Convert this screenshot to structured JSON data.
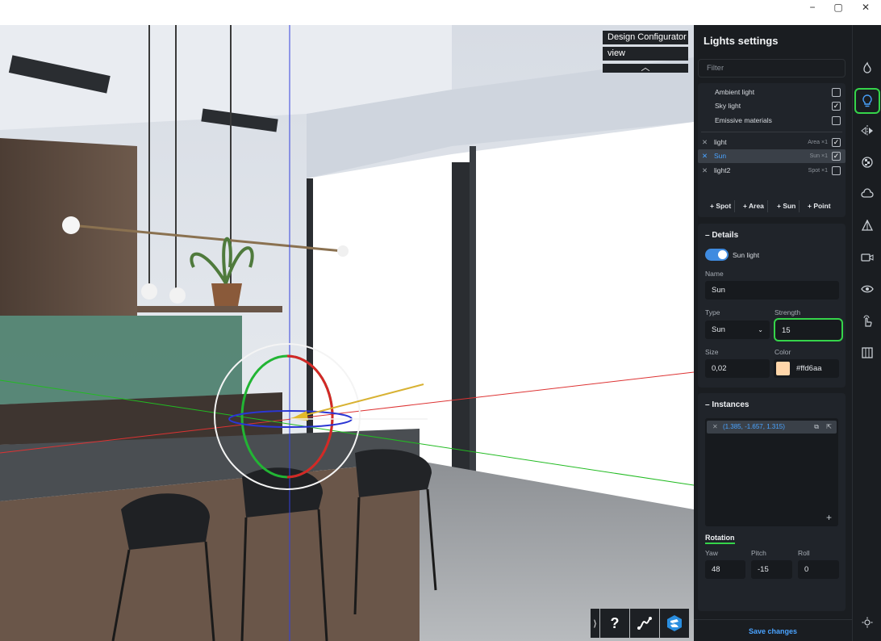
{
  "window": {
    "minimize": "−",
    "restore": "▢",
    "close": "✕"
  },
  "viewport": {
    "menu_title": "Design Configurator",
    "menu_view": "view",
    "menu_collapse": "︿",
    "tools": {
      "expand": "⟩",
      "help": "?"
    }
  },
  "panel": {
    "title": "Lights settings",
    "filter_placeholder": "Filter",
    "globals": [
      {
        "label": "Ambient light",
        "checked": false
      },
      {
        "label": "Sky light",
        "checked": true
      },
      {
        "label": "Emissive materials",
        "checked": false
      }
    ],
    "lights": [
      {
        "name": "light",
        "type": "Area ×1",
        "checked": true,
        "selected": false
      },
      {
        "name": "Sun",
        "type": "Sun ×1",
        "checked": true,
        "selected": true
      },
      {
        "name": "light2",
        "type": "Spot ×1",
        "checked": false,
        "selected": false
      }
    ],
    "add_buttons": [
      "+ Spot",
      "+ Area",
      "+ Sun",
      "+ Point"
    ],
    "details": {
      "title": "–  Details",
      "toggle_label": "Sun light",
      "toggle_on": true,
      "name_label": "Name",
      "name_value": "Sun",
      "type_label": "Type",
      "type_value": "Sun",
      "strength_label": "Strength",
      "strength_value": "15",
      "size_label": "Size",
      "size_value": "0,02",
      "color_label": "Color",
      "color_value": "#ffd6aa",
      "color_swatch": "#ffd6aa"
    },
    "instances": {
      "title": "–  Instances",
      "item": "(1.385, -1.657, 1.315)",
      "add": "+"
    },
    "rotation": {
      "tab_label": "Rotation",
      "yaw_label": "Yaw",
      "yaw_value": "48",
      "pitch_label": "Pitch",
      "pitch_value": "-15",
      "roll_label": "Roll",
      "roll_value": "0"
    },
    "save_label": "Save changes"
  },
  "colors": {
    "accent": "#4aa3ff",
    "highlight": "#35d44a",
    "panel": "#1a1d21"
  }
}
